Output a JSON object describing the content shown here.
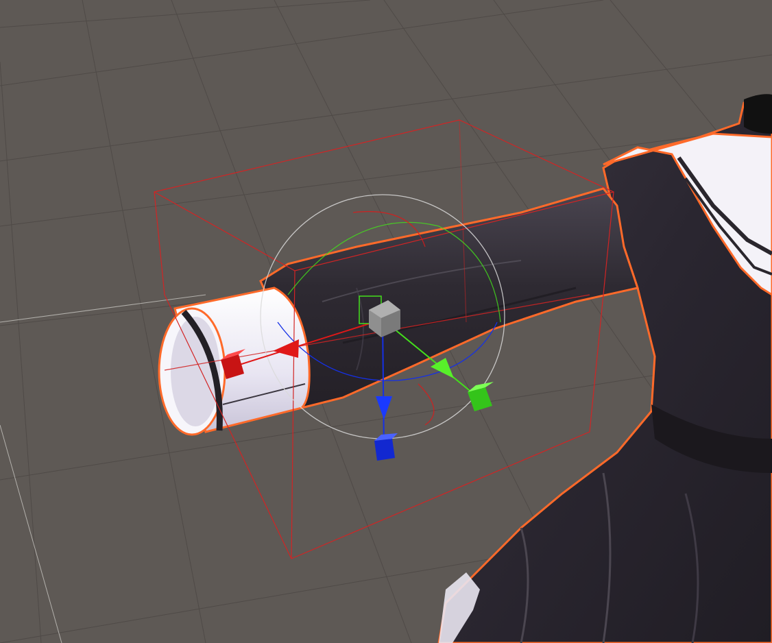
{
  "scene": {
    "background": "#5e5955",
    "grid_color": "#4f4a47",
    "grid_major_color": "#c9c6c2",
    "selection_outline": "#ff6a2a",
    "bounds_color": "#d22424",
    "fabric_dark": "#2b272d",
    "fabric_mid": "#3c3740",
    "fabric_white": "#ece9f3"
  },
  "gizmo": {
    "x_color": "#e01818",
    "y_color": "#44e01c",
    "z_color": "#1530e6",
    "center_color": "#9a9a9a",
    "ring_color": "#d9d9d9",
    "handles": [
      "x-axis-scale-handle",
      "y-axis-scale-handle",
      "z-axis-scale-handle",
      "uniform-scale-handle"
    ]
  }
}
